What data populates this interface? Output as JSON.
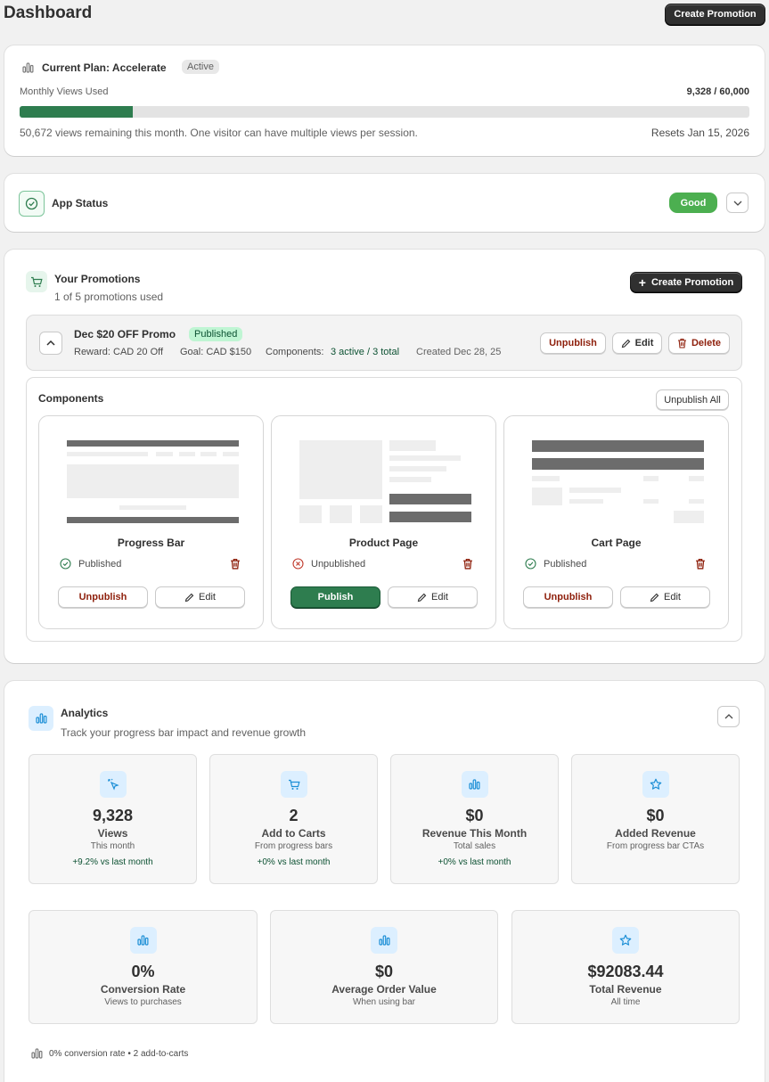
{
  "header": {
    "title": "Dashboard",
    "create_label": "Create Promotion"
  },
  "plan": {
    "title": "Current Plan: Accelerate",
    "badge": "Active",
    "views_label": "Monthly Views Used",
    "views_value": "9,328 / 60,000",
    "progress_fraction": 0.155,
    "remaining_text": "50,672 views remaining this month. One visitor can have multiple views per session.",
    "resets_text": "Resets Jan 15, 2026"
  },
  "status": {
    "title": "App Status",
    "badge": "Good"
  },
  "promotions": {
    "title": "Your Promotions",
    "subtitle": "1 of 5 promotions used",
    "create_label": "Create Promotion",
    "promo": {
      "name": "Dec $20 OFF Promo",
      "badge": "Published",
      "reward": "Reward: CAD 20 Off",
      "goal": "Goal: CAD $150",
      "components_label": "Components:",
      "components_value": "3 active / 3 total",
      "created": "Created Dec 28, 25",
      "unpublish_label": "Unpublish",
      "edit_label": "Edit",
      "delete_label": "Delete"
    },
    "components_title": "Components",
    "unpublish_all_label": "Unpublish All",
    "components": [
      {
        "name": "Progress Bar",
        "status": "Published",
        "action": "Unpublish",
        "edit": "Edit"
      },
      {
        "name": "Product Page",
        "status": "Unpublished",
        "action": "Publish",
        "edit": "Edit"
      },
      {
        "name": "Cart Page",
        "status": "Published",
        "action": "Unpublish",
        "edit": "Edit"
      }
    ]
  },
  "analytics": {
    "title": "Analytics",
    "subtitle": "Track your progress bar impact and revenue growth",
    "stats_row1": [
      {
        "value": "9,328",
        "label": "Views",
        "sub": "This month",
        "change": "+9.2% vs last month",
        "icon": "cursor-click-icon"
      },
      {
        "value": "2",
        "label": "Add to Carts",
        "sub": "From progress bars",
        "change": "+0% vs last month",
        "icon": "cart-icon"
      },
      {
        "value": "$0",
        "label": "Revenue This Month",
        "sub": "Total sales",
        "change": "+0% vs last month",
        "icon": "bar-chart-icon"
      },
      {
        "value": "$0",
        "label": "Added Revenue",
        "sub": "From progress bar CTAs",
        "change": "",
        "icon": "star-icon"
      }
    ],
    "stats_row2": [
      {
        "value": "0%",
        "label": "Conversion Rate",
        "sub": "Views to purchases",
        "icon": "bar-chart-icon"
      },
      {
        "value": "$0",
        "label": "Average Order Value",
        "sub": "When using bar",
        "icon": "bar-chart-icon"
      },
      {
        "value": "$92083.44",
        "label": "Total Revenue",
        "sub": "All time",
        "icon": "star-icon"
      }
    ],
    "footer": "0% conversion rate • 2 add-to-carts"
  },
  "colors": {
    "accent_green": "#2e7d4f",
    "good_badge": "#4caf50",
    "danger": "#8e1f0b",
    "icon_blue_bg": "#dcefff"
  }
}
